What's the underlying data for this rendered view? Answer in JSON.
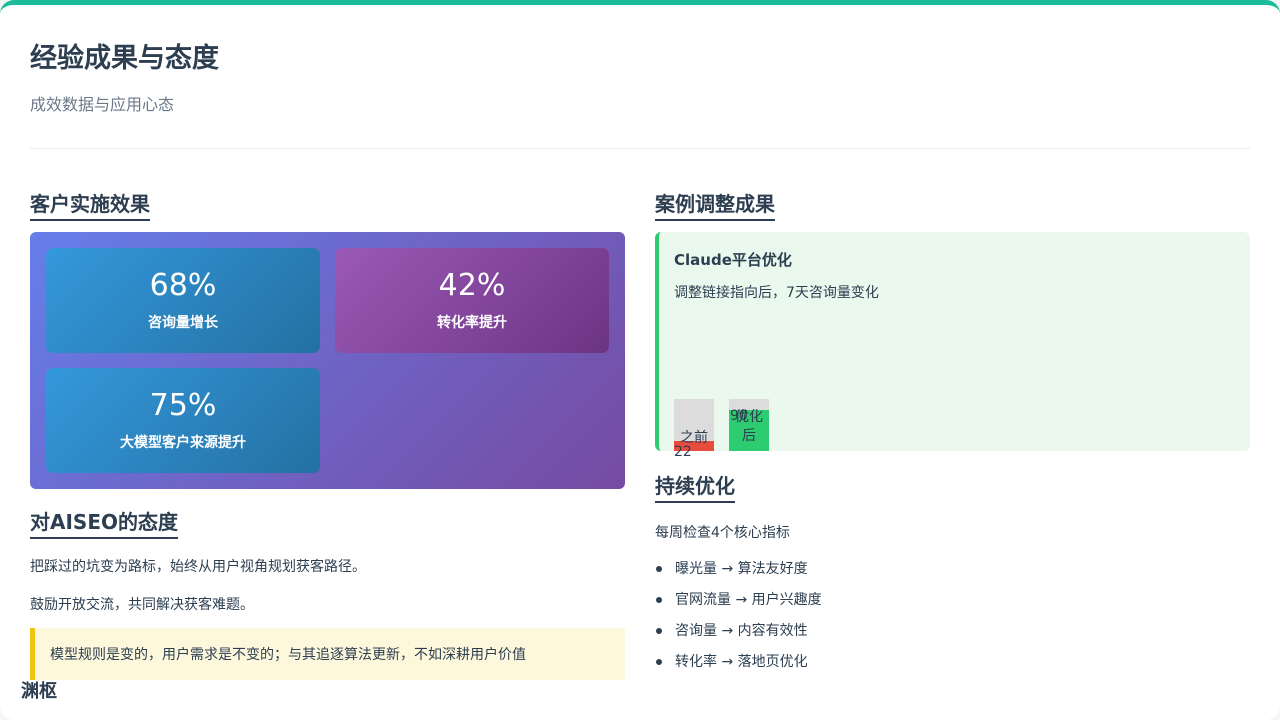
{
  "header": {
    "title": "经验成果与态度",
    "subtitle": "成效数据与应用心态"
  },
  "client_results": {
    "title": "客户实施效果",
    "stats": [
      {
        "value": "68%",
        "label": "咨询量增长"
      },
      {
        "value": "42%",
        "label": "转化率提升"
      },
      {
        "value": "75%",
        "label": "大模型客户来源提升"
      }
    ]
  },
  "attitude": {
    "title": "对AISEO的态度",
    "paragraphs": [
      "把踩过的坑变为路标，始终从用户视角规划获客路径。",
      "鼓励开放交流，共同解决获客难题。"
    ],
    "quote": "模型规则是变的，用户需求是不变的；与其追逐算法更新，不如深耕用户价值"
  },
  "case_results": {
    "title": "案例调整成果",
    "case_name": "Claude平台优化",
    "case_desc": "调整链接指向后，7天咨询量变化",
    "bars": [
      {
        "label": "之前",
        "value": "22",
        "fraction": 0.22,
        "color": "#e74c3c"
      },
      {
        "label": "优化后",
        "value": "90",
        "fraction": 0.9,
        "color": "#2ecc71"
      }
    ]
  },
  "optimization": {
    "title": "持续优化",
    "intro": "每周检查4个核心指标",
    "metrics": [
      "曝光量 → 算法友好度",
      "官网流量 → 用户兴趣度",
      "咨询量 → 内容有效性",
      "转化率 → 落地页优化"
    ]
  },
  "footer": {
    "logo_text": "渊枢"
  }
}
